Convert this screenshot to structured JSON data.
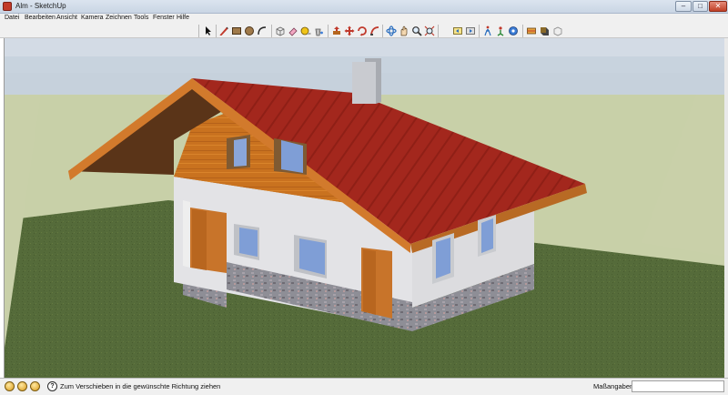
{
  "window": {
    "title": "Alm - SketchUp",
    "min_glyph": "–",
    "max_glyph": "□",
    "close_glyph": "✕",
    "close_color": "#c13f26"
  },
  "menubar": {
    "items": [
      "Datei",
      "Bearbeiten",
      "Ansicht",
      "Kamera",
      "Zeichnen",
      "Tools",
      "Fenster",
      "Hilfe"
    ]
  },
  "toolbar": {
    "tools": [
      "select-arrow-icon",
      "pencil-line-icon",
      "rectangle-icon",
      "circle-icon",
      "arc-icon",
      "make-component-icon",
      "eraser-icon",
      "tape-measure-icon",
      "paint-bucket-icon",
      "push-pull-icon",
      "move-icon",
      "rotate-icon",
      "follow-me-icon",
      "offset-icon",
      "orbit-icon",
      "pan-icon",
      "zoom-icon",
      "zoom-extents-icon",
      "previous-view-icon",
      "next-view-icon",
      "walk-icon",
      "position-camera-icon",
      "look-around-icon",
      "section-plane-icon",
      "shadow-settings-icon",
      "components-icon"
    ]
  },
  "scene": {
    "sky_color": "#c7d3df",
    "ground_color": "#556b3a",
    "roof_color": "#a3271d",
    "wood_color": "#c9721f",
    "wall_color": "#e4e4e6",
    "stone_color": "#8e8e96",
    "glass_color": "#7f9ed6"
  },
  "statusbar": {
    "message": "Zum Verschieben in die gewünschte Richtung ziehen",
    "vcb_label": "Maßangaben",
    "vcb_value": "",
    "help_glyph": "?"
  }
}
